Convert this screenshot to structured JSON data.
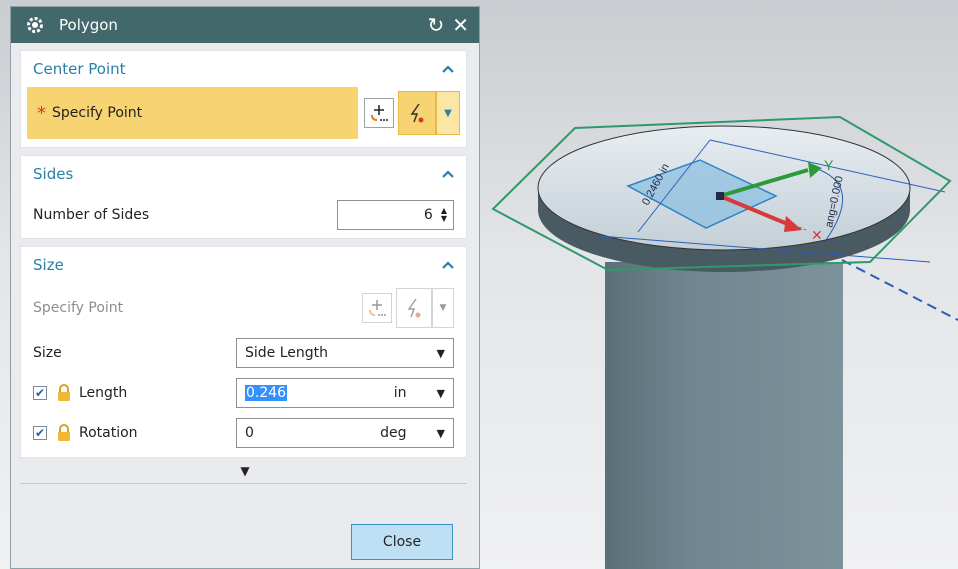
{
  "dialog": {
    "title": "Polygon",
    "close_label": "Close"
  },
  "center_point": {
    "header": "Center Point",
    "specify_point_label": "Specify Point",
    "required_marker": "*"
  },
  "sides": {
    "header": "Sides",
    "number_of_sides_label": "Number of Sides",
    "number_of_sides_value": "6"
  },
  "size": {
    "header": "Size",
    "specify_point_label": "Specify Point",
    "size_label": "Size",
    "size_option": "Side Length",
    "length_label": "Length",
    "length_value": "0.246",
    "length_unit": "in",
    "rotation_label": "Rotation",
    "rotation_value": "0",
    "rotation_unit": "deg"
  },
  "viewport": {
    "dimension_length": "0.2460 in",
    "dimension_angle": "ang=0.000",
    "axis_y_label": "Y",
    "polygon_color": "#2e9a6a",
    "cylinder_color": "#6f8590"
  },
  "colors": {
    "titlebar": "#43686b",
    "accent": "#2a7fa9",
    "highlight": "#f8d372",
    "close_button": "#bfe0f4"
  }
}
